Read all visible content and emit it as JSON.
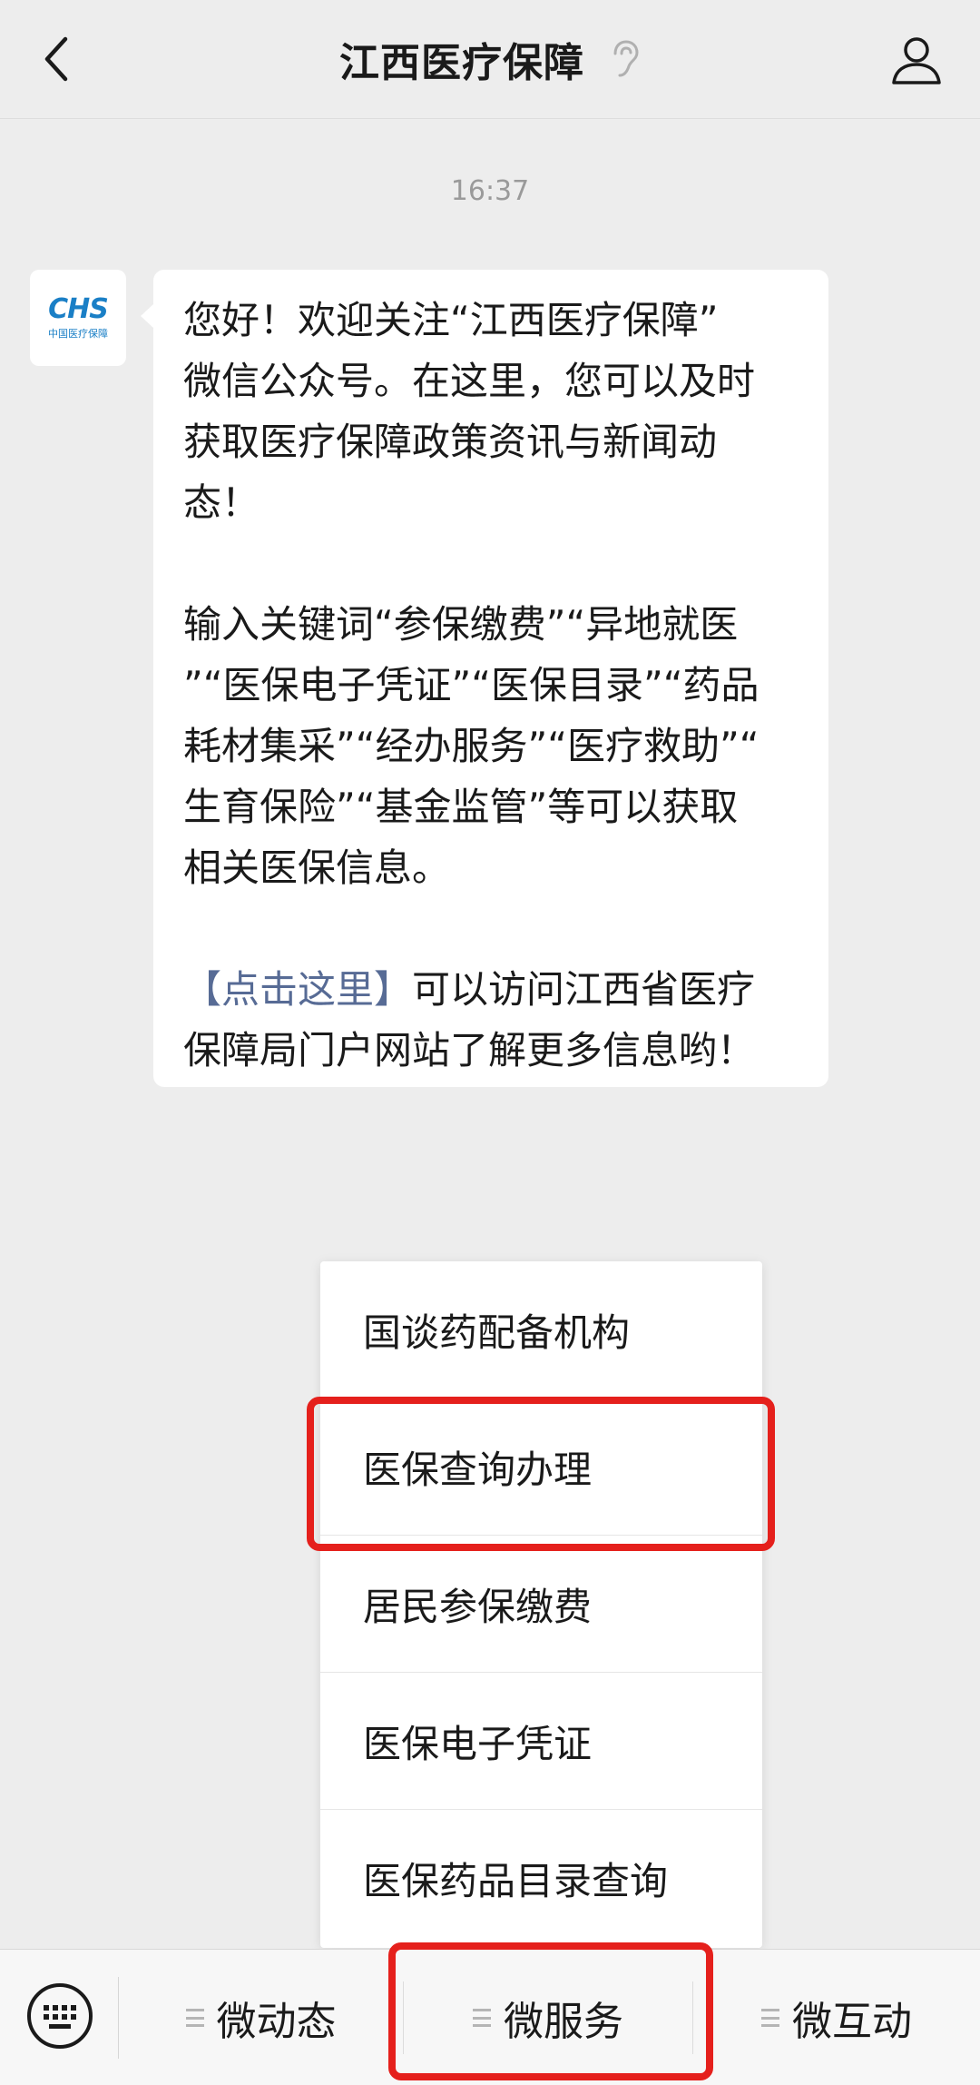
{
  "header": {
    "title": "江西医疗保障",
    "back_icon": "chevron-left-icon",
    "ear_icon": "ear-icon",
    "profile_icon": "person-icon"
  },
  "chat": {
    "timestamp": "16:37",
    "avatar": {
      "logo_text": "CHS",
      "logo_sub": "中国医疗保障"
    },
    "message": {
      "line_1": "您好！欢迎关注“江西医疗保障”",
      "line_2": "微信公众号。在这里，您可以及时",
      "line_3": "获取医疗保障政策资讯与新闻动",
      "line_4": "态！",
      "line_5": "输入关键词“参保缴费”“异地就医",
      "line_6": "”“医保电子凭证”“医保目录”“药品",
      "line_7": "耗材集采”“经办服务”“医疗救助”“",
      "line_8": "生育保险”“基金监管”等可以获取",
      "line_9": "相关医保信息。",
      "link_text": "【点击这里】",
      "line_10_rest": "可以访问江西省医疗",
      "line_11": "保障局门户网站了解更多信息哟！"
    }
  },
  "popup_menu": {
    "items": [
      {
        "label": "国谈药配备机构"
      },
      {
        "label": "医保查询办理",
        "highlighted": true
      },
      {
        "label": "居民参保缴费"
      },
      {
        "label": "医保电子凭证"
      },
      {
        "label": "医保药品目录查询"
      }
    ]
  },
  "bottom_bar": {
    "keyboard_icon": "keyboard-icon",
    "tabs": [
      {
        "label": "微动态"
      },
      {
        "label": "微服务",
        "highlighted": true
      },
      {
        "label": "微互动"
      }
    ]
  },
  "colors": {
    "highlight": "#e5201c",
    "link": "#576b95",
    "logo": "#1a7fc6"
  }
}
